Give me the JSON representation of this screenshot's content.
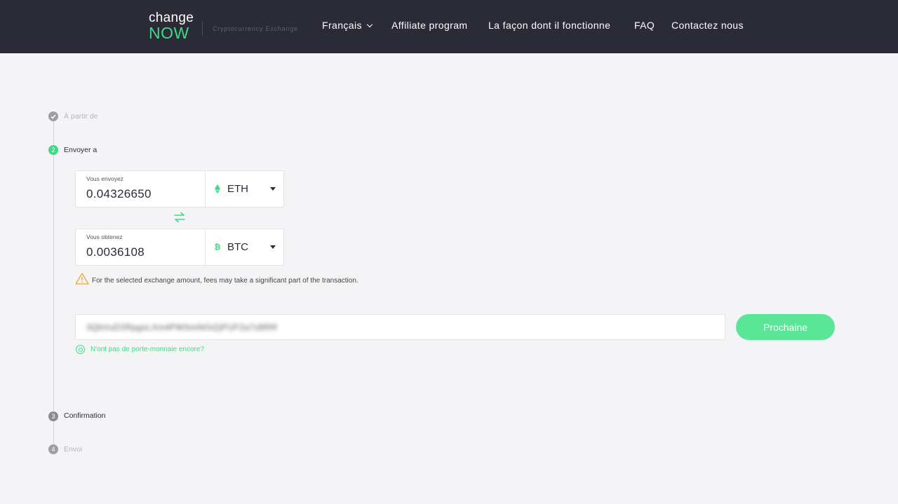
{
  "header": {
    "logo_top": "change",
    "logo_bottom": "NOW",
    "tagline": "Cryptocurrency Exchange",
    "nav": [
      {
        "label": "Français"
      },
      {
        "label": "Affiliate program"
      },
      {
        "label": "La façon dont il fonctionne"
      },
      {
        "label": "FAQ"
      },
      {
        "label": "Contactez nous"
      }
    ]
  },
  "steps": [
    {
      "number": "",
      "label": "À partir de",
      "state": "done"
    },
    {
      "number": "2",
      "label": "Envoyer a",
      "state": "active"
    },
    {
      "number": "3",
      "label": "Confirmation",
      "state": "pending"
    },
    {
      "number": "4",
      "label": "Envoi",
      "state": "upcoming"
    }
  ],
  "exchange": {
    "send": {
      "caption": "Vous envoyez",
      "amount": "0.04326650",
      "currency": "ETH",
      "icon": "ethereum-icon"
    },
    "receive": {
      "caption": "Vous obtenez",
      "amount": "0.0036108",
      "currency": "BTC",
      "icon": "bitcoin-icon"
    },
    "swap_icon": "swap-arrows-icon",
    "warning": "For the selected exchange amount, fees may take a significant part of the transaction."
  },
  "address": {
    "value": "3QbVuD2RpgsLXm4PWSmNGtZjPUF2a7zBRR"
  },
  "next_button": "Prochaine",
  "wallet_link": "N'ont pas de porte-monnaie encore?",
  "colors": {
    "header_bg": "#2b2b37",
    "accent": "#3fda86",
    "button": "#5be697",
    "page_bg": "#f4f4f6",
    "warning": "#f0a830"
  }
}
